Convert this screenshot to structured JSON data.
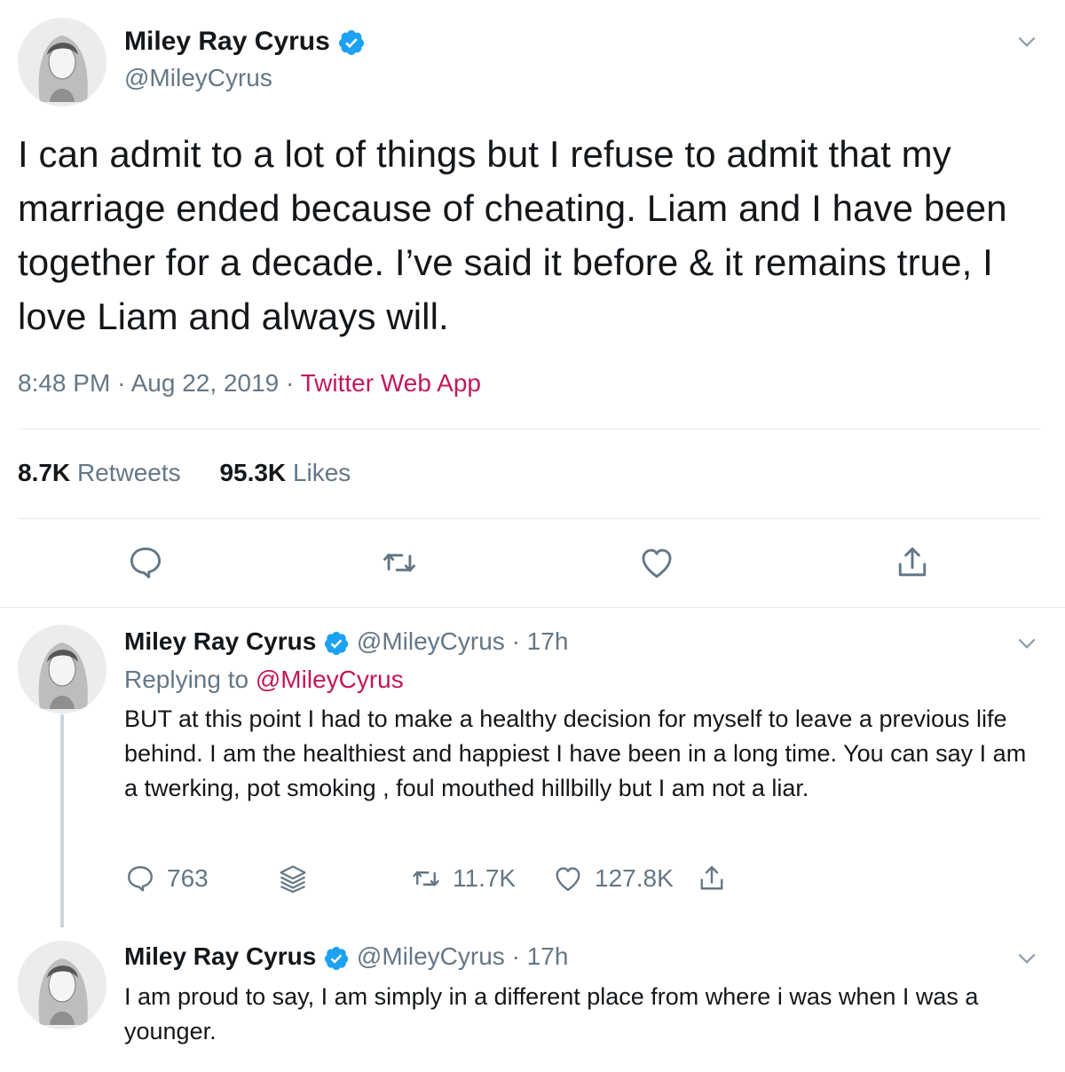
{
  "main_tweet": {
    "author_name": "Miley Ray Cyrus",
    "handle": "@MileyCyrus",
    "text": "I can admit to a lot of things but I refuse to admit that my marriage ended because of cheating. Liam and I have been together for a decade. I’ve said it before & it remains true, I love Liam and always will.",
    "time": "8:48 PM",
    "date": "Aug 22, 2019",
    "source": "Twitter Web App",
    "separator": "·",
    "retweets_count": "8.7K",
    "retweets_label": "Retweets",
    "likes_count": "95.3K",
    "likes_label": "Likes"
  },
  "replies": [
    {
      "author_name": "Miley Ray Cyrus",
      "handle": "@MileyCyrus",
      "time_ago": "17h",
      "replying_label": "Replying to",
      "replying_handle": "@MileyCyrus",
      "text": "BUT at this point I had to make a healthy decision for myself to leave a previous life behind. I am the healthiest and happiest I have been in a long time.  You can say I am a twerking, pot smoking , foul mouthed hillbilly but I am not a liar.",
      "reply_count": "763",
      "retweet_count": "11.7K",
      "like_count": "127.8K"
    },
    {
      "author_name": "Miley Ray Cyrus",
      "handle": "@MileyCyrus",
      "time_ago": "17h",
      "text": "I am proud to say, I am simply in a different place from where i was when I was a younger."
    }
  ],
  "colors": {
    "verified": "#1da1f2",
    "link": "#c2185b",
    "muted": "#657786",
    "icon": "#657786"
  },
  "icons": {
    "verified": "verified-badge-icon",
    "chevron": "chevron-down-icon",
    "reply": "reply-icon",
    "retweet": "retweet-icon",
    "like": "heart-icon",
    "share": "share-icon",
    "stack": "layers-icon"
  }
}
